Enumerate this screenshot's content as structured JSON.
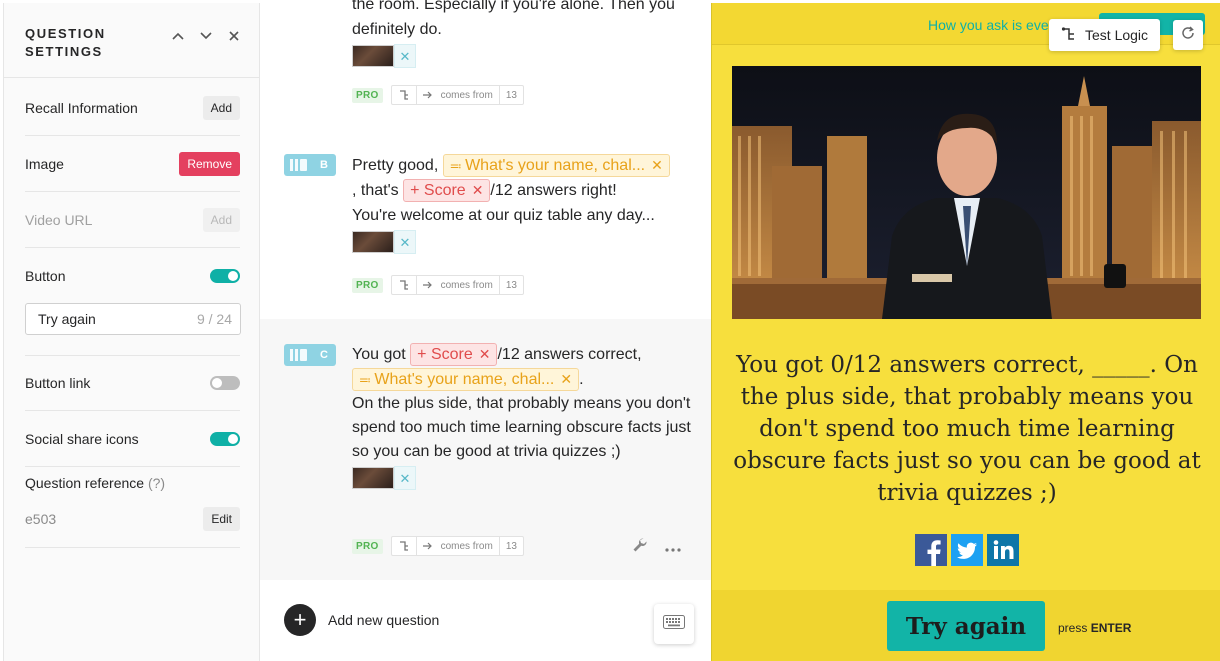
{
  "settings": {
    "title": "QUESTION SETTINGS",
    "recall_label": "Recall Information",
    "recall_btn": "Add",
    "image_label": "Image",
    "image_btn": "Remove",
    "video_label": "Video URL",
    "video_btn": "Add",
    "button_label": "Button",
    "button_on": true,
    "button_text_value": "Try again",
    "button_text_count": "9 / 24",
    "button_link_label": "Button link",
    "button_link_on": false,
    "social_label": "Social share icons",
    "social_on": true,
    "ref_label": "Question reference",
    "ref_hint": "(?)",
    "ref_value": "e503",
    "ref_btn": "Edit"
  },
  "editor": {
    "block_a": {
      "text_line1": "the room. Especially if you're alone. Then you",
      "text_line2": "definitely do.",
      "pro": "PRO",
      "comes_from": "comes from",
      "count": "13"
    },
    "block_b": {
      "badge": "B",
      "text_start": "Pretty good,",
      "var_pill": "What's your name, chal...",
      "text_mid": ", that's",
      "score_pill": "Score",
      "text_end": "/12 answers right!",
      "text_line3": "You're welcome at our quiz table any day...",
      "pro": "PRO",
      "comes_from": "comes from",
      "count": "13"
    },
    "block_c": {
      "badge": "C",
      "text_start": "You got",
      "score_pill": "Score",
      "text_mid": "/12 answers correct,",
      "var_pill": "What's your name, chal...",
      "text_dot": ".",
      "text_rest": "On the plus side, that probably means you don't spend too much time learning obscure facts just so you can be good at trivia quizzes ;)",
      "pro": "PRO",
      "comes_from": "comes from",
      "count": "13"
    },
    "add_question": "Add new question"
  },
  "preview": {
    "topbar_text": "How you ask is eve",
    "test_logic": "Test Logic",
    "result_text": "You got 0/12 answers correct, _____. On the plus side, that probably means you don't spend too much time learning obscure facts just so you can be good at trivia quizzes ;)",
    "button": "Try again",
    "press_prefix": "press",
    "press_key": "ENTER",
    "colors": {
      "background": "#f7df3d",
      "button": "#12b4a7",
      "facebook": "#3b5998",
      "twitter": "#1da1f2",
      "linkedin": "#0e76a8"
    }
  }
}
